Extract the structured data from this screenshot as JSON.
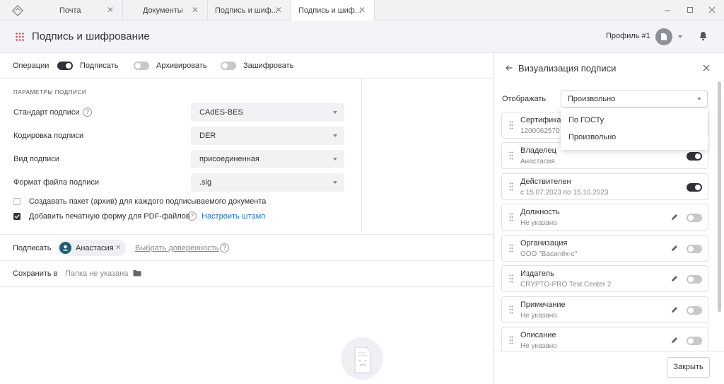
{
  "tabs": [
    {
      "label": "Почта"
    },
    {
      "label": "Документы"
    },
    {
      "label": "Подпись и шиф..."
    },
    {
      "label": "Подпись и шиф..."
    }
  ],
  "header": {
    "title": "Подпись и шифрование",
    "profile": "Профиль #1"
  },
  "operations": {
    "label": "Операции",
    "items": [
      {
        "label": "Подписать",
        "on": true
      },
      {
        "label": "Архивировать",
        "on": false
      },
      {
        "label": "Зашифровать",
        "on": false
      }
    ]
  },
  "params": {
    "section_title": "ПАРАМЕТРЫ ПОДПИСИ",
    "rows": [
      {
        "label": "Стандарт подписи",
        "value": "CAdES-BES"
      },
      {
        "label": "Кодировка подписи",
        "value": "DER"
      },
      {
        "label": "Вид подписи",
        "value": "присоединенная"
      },
      {
        "label": "Формат файла подписи",
        "value": ".sig"
      }
    ],
    "checkboxes": [
      {
        "label": "Создавать пакет (архив) для каждого подписываемого документа",
        "checked": false
      },
      {
        "label": "Добавить печатную форму для PDF-файлов",
        "checked": true
      }
    ],
    "stamp_link": "Настроить штамп"
  },
  "signer": {
    "label": "Подписать",
    "name": "Анастасия",
    "proxy_link": "Выбрать доверенность"
  },
  "save": {
    "label": "Сохранить в",
    "value": "Папка не указана"
  },
  "panel": {
    "title": "Визуализация подписи",
    "display_label": "Отображать",
    "display_value": "Произвольно",
    "options": [
      "По ГОСТу",
      "Произвольно"
    ],
    "cards": [
      {
        "label": "Сертификат",
        "value": "1200062570",
        "toggle": "none"
      },
      {
        "label": "Владелец",
        "value": "Анастасия",
        "toggle": "on"
      },
      {
        "label": "Действителен",
        "value": "с 15.07.2023 по 15.10.2023",
        "toggle": "on"
      },
      {
        "label": "Должность",
        "value": "Не указано",
        "toggle": "off"
      },
      {
        "label": "Организация",
        "value": "ООО \"Василёк-с\"",
        "toggle": "off"
      },
      {
        "label": "Издатель",
        "value": "CRYPTO-PRO Test Center 2",
        "toggle": "off"
      },
      {
        "label": "Примечание",
        "value": "Не указано",
        "toggle": "off"
      },
      {
        "label": "Описание",
        "value": "Не указано",
        "toggle": "off"
      }
    ],
    "close_label": "Закрыть"
  },
  "colors": {
    "accent": "#1a73c9",
    "toggle_on": "#2f3136",
    "chip_avatar": "#1d5d76"
  }
}
